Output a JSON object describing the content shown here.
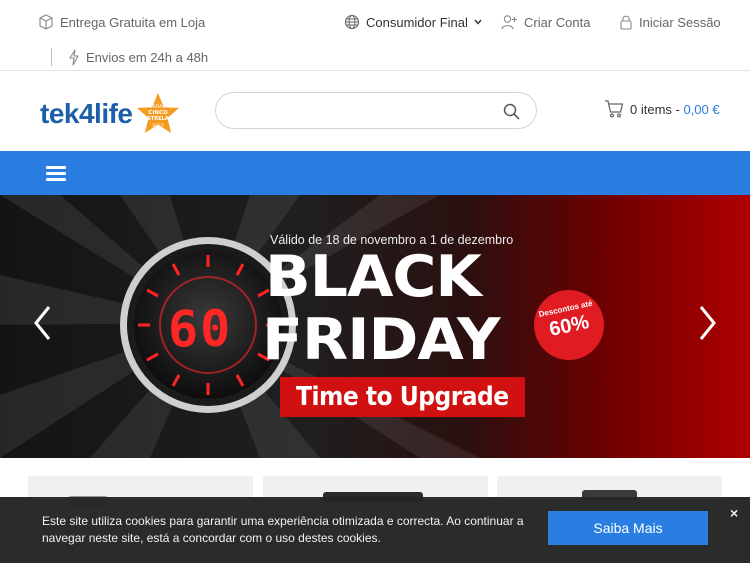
{
  "topbar": {
    "free_delivery": "Entrega Gratuita em Loja",
    "shipping": "Envios em 24h a 48h",
    "customer_type": "Consumidor Final",
    "create_account": "Criar Conta",
    "login": "Iniciar Sessão"
  },
  "header": {
    "logo_text": "tek4life",
    "logo_badge_top": "PRÉMIO",
    "logo_badge_main1": "CINCO",
    "logo_badge_main2": "ESTRELAS",
    "logo_badge_year": "2023",
    "search_placeholder": "",
    "cart_items": "0 items",
    "cart_sep": " - ",
    "cart_price": "0,00 €"
  },
  "hero": {
    "subtitle": "Válido de 18 de novembro a 1 de dezembro",
    "title_line1": "BLACK",
    "title_line2": "FRIDAY",
    "tagline": "Time to Upgrade",
    "badge_top": "Descontos até",
    "badge_value": "60%",
    "timer_value": "60"
  },
  "cookie": {
    "text": "Este site utiliza cookies para garantir uma experiência otimizada e correcta. Ao continuar a navegar neste site, está a concordar com o uso destes cookies.",
    "button": "Saiba Mais",
    "close": "×"
  },
  "colors": {
    "primary": "#2a7de1",
    "logo": "#1d5fa8",
    "promo_red": "#d11111"
  }
}
